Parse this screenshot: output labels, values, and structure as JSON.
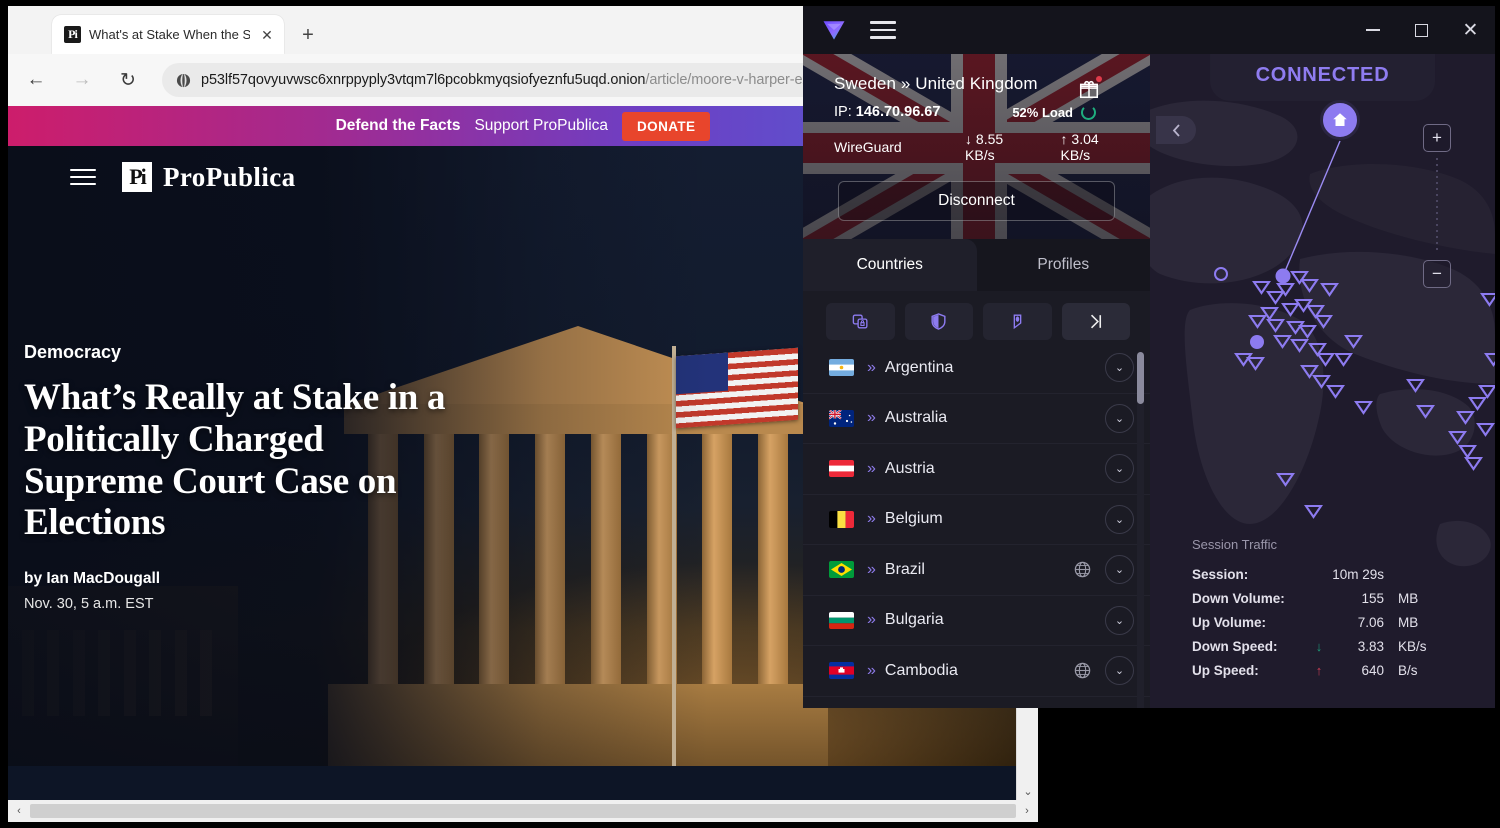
{
  "browser": {
    "tab": {
      "favicon": "propublica-favicon",
      "title": "What's at Stake When the Supre",
      "close_label": "✕",
      "new_tab_label": "+"
    },
    "nav": {
      "back": "←",
      "forward": "→",
      "reload": "↻"
    },
    "url": {
      "host": "p53lf57qovyuvwsc6xnrppyply3vtqm7l6pcobkmyqsiofyeznfu5uqd.onion",
      "path": "/article/moore-v-harper-expla",
      "security_icon": "onion-icon"
    },
    "scroll": {
      "left_arrow": "‹",
      "right_arrow": "›",
      "down_arrow": "⌄"
    }
  },
  "site": {
    "banner": {
      "bold": "Defend the Facts",
      "regular": "Support ProPublica",
      "button": "DONATE"
    },
    "logo_mark": "Pi",
    "logo_text": "ProPublica",
    "menu_icon": "hamburger-icon"
  },
  "article": {
    "kicker": "Democracy",
    "headline": "What’s Really at Stake in a Politically Charged Supreme Court Case on Elections",
    "byline": "by Ian MacDougall",
    "date": "Nov. 30, 5 a.m. EST"
  },
  "vpn": {
    "window": {
      "minimize": "—",
      "maximize": "□",
      "close": "✕",
      "menu_icon": "hamburger-icon",
      "logo_icon": "protonvpn-logo-icon"
    },
    "status": {
      "route": "Sweden » United Kingdom",
      "ip_label": "IP:",
      "ip": "146.70.96.67",
      "protocol": "WireGuard",
      "load": "52% Load",
      "down_rate": "8.55 KB/s",
      "up_rate": "3.04 KB/s",
      "down_arrow": "↓",
      "up_arrow": "↑",
      "disconnect": "Disconnect",
      "gift_icon": "gift-icon"
    },
    "tabs": [
      {
        "label": "Countries",
        "active": true
      },
      {
        "label": "Profiles",
        "active": false
      }
    ],
    "tools": [
      {
        "name": "secure-core-icon"
      },
      {
        "name": "netshield-icon"
      },
      {
        "name": "tor-onion-icon"
      },
      {
        "name": "quick-connect-icon"
      }
    ],
    "countries": [
      {
        "flag": "argentina-flag",
        "name": "Argentina",
        "has_globe": false
      },
      {
        "flag": "australia-flag",
        "name": "Australia",
        "has_globe": false
      },
      {
        "flag": "austria-flag",
        "name": "Austria",
        "has_globe": false
      },
      {
        "flag": "belgium-flag",
        "name": "Belgium",
        "has_globe": false
      },
      {
        "flag": "brazil-flag",
        "name": "Brazil",
        "has_globe": true
      },
      {
        "flag": "bulgaria-flag",
        "name": "Bulgaria",
        "has_globe": false
      },
      {
        "flag": "cambodia-flag",
        "name": "Cambodia",
        "has_globe": true
      }
    ],
    "map": {
      "status": "CONNECTED",
      "collapse_icon": "chevron-left-icon",
      "home_icon": "home-icon",
      "zoom_in": "+",
      "zoom_out": "−"
    },
    "session": {
      "title": "Session Traffic",
      "rows": [
        {
          "label": "Session:",
          "arrow": "",
          "value": "10m 29s",
          "unit": ""
        },
        {
          "label": "Down Volume:",
          "arrow": "",
          "value": "155",
          "unit": "MB"
        },
        {
          "label": "Up Volume:",
          "arrow": "",
          "value": "7.06",
          "unit": "MB"
        },
        {
          "label": "Down Speed:",
          "arrow": "↓",
          "value": "3.83",
          "unit": "KB/s"
        },
        {
          "label": "Up Speed:",
          "arrow": "↑",
          "value": "640",
          "unit": "B/s"
        }
      ]
    }
  },
  "colors": {
    "accent_purple": "#8d7bf0",
    "donate_red": "#e8452c",
    "load_green": "#1fae7e",
    "down_green": "#1d9c79",
    "up_red": "#cc3f55"
  }
}
